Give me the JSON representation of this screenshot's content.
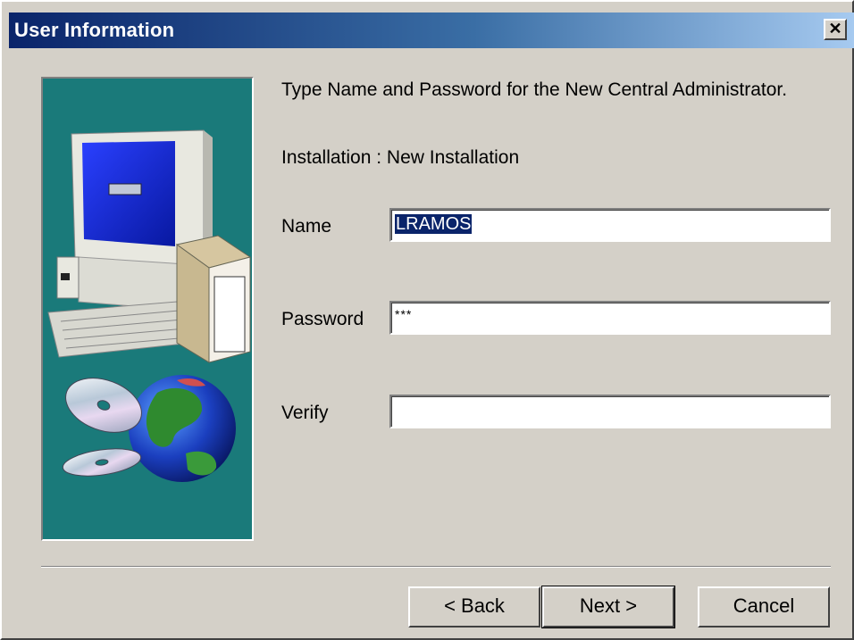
{
  "window": {
    "title": "User Information",
    "close_label": "✕"
  },
  "content": {
    "instruction": "Type Name and Password for the New Central Administrator.",
    "installation_label": "Installation : New Installation"
  },
  "form": {
    "name_label": "Name",
    "name_value": "LRAMOS",
    "password_label": "Password",
    "password_value": "***",
    "verify_label": "Verify",
    "verify_value": ""
  },
  "buttons": {
    "back": "< Back",
    "next": "Next >",
    "cancel": "Cancel"
  },
  "colors": {
    "titlebar_start": "#0a246a",
    "titlebar_end": "#a6caf0",
    "art_background": "#1a7a7a",
    "dialog_face": "#d4d0c8"
  },
  "icons": [
    "computer-icon",
    "software-box-icon",
    "cd-disc-icon",
    "globe-icon"
  ]
}
